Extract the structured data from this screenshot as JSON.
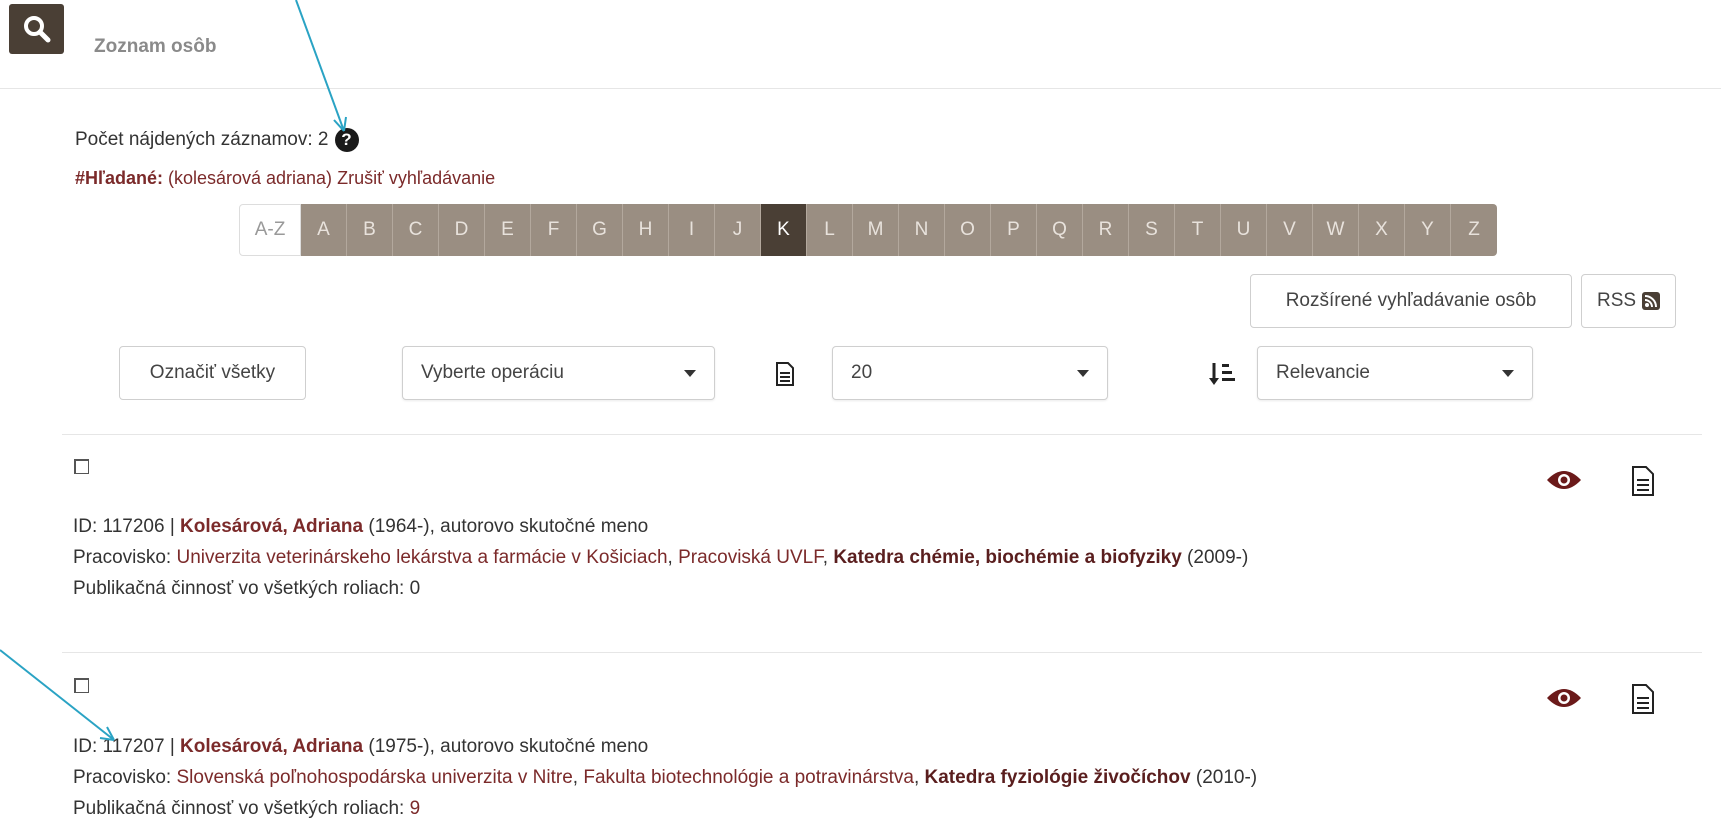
{
  "header": {
    "title": "Zoznam osôb"
  },
  "results": {
    "count_label": "Počet nájdených záznamov: 2",
    "search_label": "#Hľadané:",
    "search_query": " (kolesárová adriana)",
    "cancel_search": "Zrušiť vyhľadávanie"
  },
  "alphabet": {
    "all_label": "A-Z",
    "letters": [
      "A",
      "B",
      "C",
      "D",
      "E",
      "F",
      "G",
      "H",
      "I",
      "J",
      "K",
      "L",
      "M",
      "N",
      "O",
      "P",
      "Q",
      "R",
      "S",
      "T",
      "U",
      "V",
      "W",
      "X",
      "Y",
      "Z"
    ],
    "active": "K"
  },
  "toolbar": {
    "advanced_search": "Rozšírené vyhľadávanie osôb",
    "rss": "RSS",
    "select_all": "Označiť všetky",
    "operation_select": "Vyberte operáciu",
    "page_size": "20",
    "sort": "Relevancie"
  },
  "records": [
    {
      "id_prefix": "ID: 117206 | ",
      "name": "Kolesárová, Adriana",
      "years": " (1964-), autorovo skutočné meno",
      "work_label": "Pracovisko: ",
      "university": "Univerzita veterinárskeho lekárstva a farmácie v Košiciach",
      "sep1": ", ",
      "faculty": "Pracoviská UVLF",
      "sep2": ", ",
      "department": "Katedra chémie, biochémie a biofyziky",
      "dept_years": " (2009-)",
      "pub_label": "Publikačná činnosť vo všetkých roliach: ",
      "pub_count": "0"
    },
    {
      "id_prefix": "ID: 117207 | ",
      "name": "Kolesárová, Adriana",
      "years": " (1975-), autorovo skutočné meno",
      "work_label": "Pracovisko: ",
      "university": "Slovenská poľnohospodárska univerzita v Nitre",
      "sep1": ", ",
      "faculty": "Fakulta biotechnológie a potravinárstva",
      "sep2": ", ",
      "department": "Katedra fyziológie živočíchov",
      "dept_years": " (2010-)",
      "pub_label": "Publikačná činnosť vo všetkých roliach: ",
      "pub_count": "9"
    }
  ],
  "colors": {
    "brand_dark": "#4a3f35",
    "alphabet_bg": "#9a8e82",
    "link": "#7b2a2a",
    "annotation_arrow": "#2aa3c4"
  }
}
